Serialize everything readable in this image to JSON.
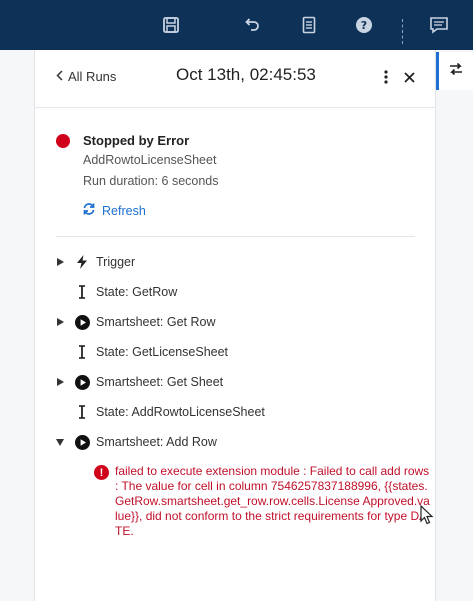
{
  "header": {
    "back_label": "All Runs",
    "title": "Oct 13th, 02:45:53"
  },
  "status": {
    "title": "Stopped by Error",
    "flow_name": "AddRowtoLicenseSheet",
    "duration": "Run duration: 6 seconds",
    "refresh_label": "Refresh",
    "error_color": "#d0021b"
  },
  "steps": [
    {
      "label": "Trigger",
      "icon": "lightning-icon",
      "expandable": true,
      "expanded": false
    },
    {
      "label": "State: GetRow",
      "icon": "state-icon",
      "expandable": false
    },
    {
      "label": "Smartsheet: Get Row",
      "icon": "play-circle-icon",
      "expandable": true,
      "expanded": false
    },
    {
      "label": "State: GetLicenseSheet",
      "icon": "state-icon",
      "expandable": false
    },
    {
      "label": "Smartsheet: Get Sheet",
      "icon": "play-circle-icon",
      "expandable": true,
      "expanded": false
    },
    {
      "label": "State: AddRowtoLicenseSheet",
      "icon": "state-icon",
      "expandable": false
    },
    {
      "label": "Smartsheet: Add Row",
      "icon": "play-circle-icon",
      "expandable": true,
      "expanded": true
    }
  ],
  "error_message": "failed to execute extension module : Failed to call add rows : The value for cell in column 7546257837188996, {{states.GetRow.smartsheet.get_row.row.cells.License Approved.value}}, did not conform to the strict requirements for type DATE.",
  "colors": {
    "topbar": "#0e3158",
    "accent": "#1d6fd1",
    "error_text": "#c0102a"
  }
}
